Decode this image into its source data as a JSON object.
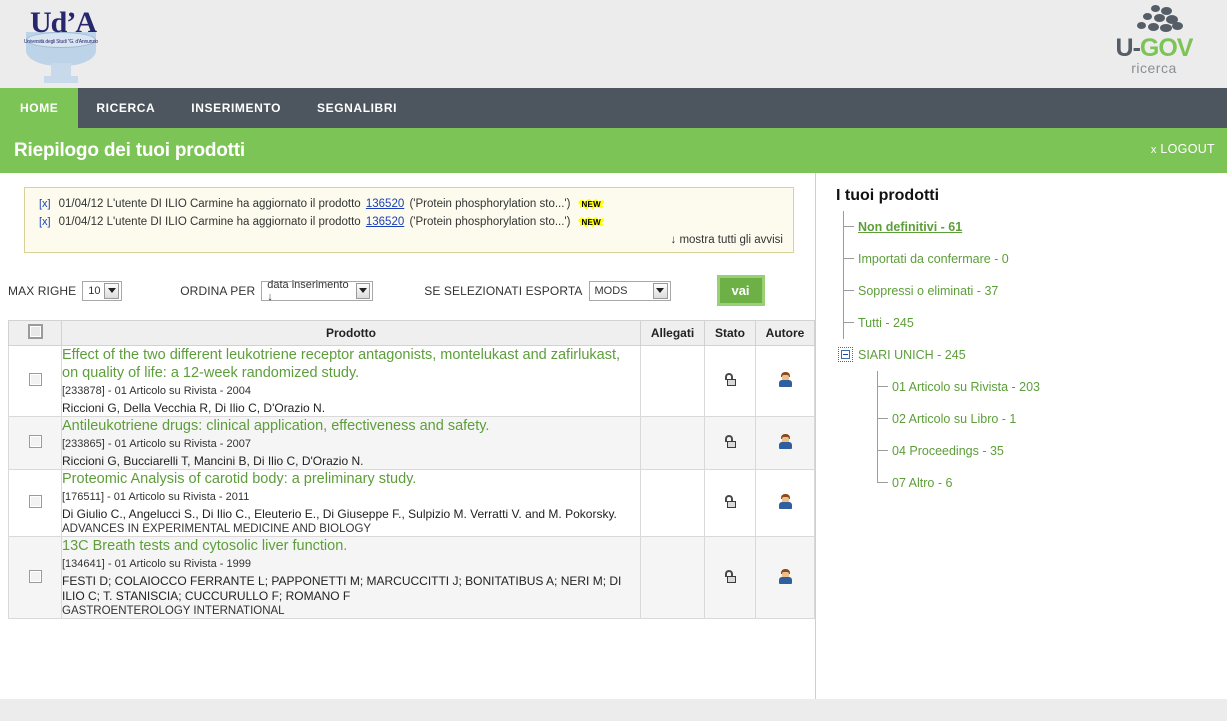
{
  "branding": {
    "uda_text": "Ud’A",
    "uda_subtitle": "Università degli Studi \"G. d'Annunzio\"",
    "ugov_u": "U-",
    "ugov_gov": "GOV",
    "ugov_sub": "ricerca"
  },
  "nav": {
    "items": [
      {
        "label": "HOME",
        "active": true
      },
      {
        "label": "RICERCA",
        "active": false
      },
      {
        "label": "INSERIMENTO",
        "active": false
      },
      {
        "label": "SEGNALIBRI",
        "active": false
      }
    ]
  },
  "banner": {
    "title": "Riepilogo dei tuoi prodotti",
    "logout_x": "x",
    "logout_label": "LOGOUT"
  },
  "notices": {
    "close_label": "[x]",
    "items": [
      {
        "date": "01/04/12",
        "text_before": "L'utente DI ILIO Carmine ha aggiornato il prodotto",
        "product_id": "136520",
        "text_after": "('Protein phosphorylation sto...')",
        "badge": "NEW"
      },
      {
        "date": "01/04/12",
        "text_before": "L'utente DI ILIO Carmine ha aggiornato il prodotto",
        "product_id": "136520",
        "text_after": "('Protein phosphorylation sto...')",
        "badge": "NEW"
      }
    ],
    "show_all": "↓ mostra tutti gli avvisi"
  },
  "toolbar": {
    "max_righe_label": "MAX RIGHE",
    "max_righe_value": "10",
    "ordina_per_label": "ORDINA PER",
    "ordina_per_value": "data inserimento ↓",
    "esporta_label": "SE SELEZIONATI ESPORTA",
    "esporta_value": "MODS",
    "go_label": "vai"
  },
  "table": {
    "headers": {
      "select": "",
      "prodotto": "Prodotto",
      "allegati": "Allegati",
      "stato": "Stato",
      "autore": "Autore"
    },
    "rows": [
      {
        "title": "Effect of the two different leukotriene receptor antagonists, montelukast and zafirlukast, on quality of life: a 12-week randomized study.",
        "meta": "[233878] - 01 Articolo su Rivista - 2004",
        "authors": "Riccioni G, Della Vecchia R, Di Ilio C, D'Orazio N.",
        "journal": "",
        "allegati": "",
        "stato_icon": "open-padlock-icon",
        "autore_icon": "user-avatar-icon"
      },
      {
        "title": "Antileukotriene drugs: clinical application, effectiveness and safety.",
        "meta": "[233865] - 01 Articolo su Rivista - 2007",
        "authors": "Riccioni G, Bucciarelli T, Mancini B, Di Ilio C, D'Orazio N.",
        "journal": "",
        "allegati": "",
        "stato_icon": "open-padlock-icon",
        "autore_icon": "user-avatar-icon"
      },
      {
        "title": "Proteomic Analysis of carotid body: a preliminary study.",
        "meta": "[176511] - 01 Articolo su Rivista - 2011",
        "authors": "Di Giulio C., Angelucci S., Di Ilio C., Eleuterio E., Di Giuseppe F., Sulpizio M. Verratti V. and M. Pokorsky.",
        "journal": "ADVANCES IN EXPERIMENTAL MEDICINE AND BIOLOGY",
        "allegati": "",
        "stato_icon": "open-padlock-icon",
        "autore_icon": "user-avatar-icon"
      },
      {
        "title": "13C Breath tests and cytosolic liver function.",
        "meta": "[134641] - 01 Articolo su Rivista - 1999",
        "authors": "FESTI D; COLAIOCCO FERRANTE L; PAPPONETTI M; MARCUCCITTI J; BONITATIBUS A; NERI M; DI ILIO C; T. STANISCIA; CUCCURULLO F; ROMANO F",
        "journal": "GASTROENTEROLOGY INTERNATIONAL",
        "allegati": "",
        "stato_icon": "open-padlock-icon",
        "autore_icon": "user-avatar-icon"
      }
    ]
  },
  "sidebar": {
    "title": "I tuoi prodotti",
    "nodes": [
      {
        "label": "Non definitivi - 61",
        "current": true
      },
      {
        "label": "Importati da confermare - 0",
        "current": false
      },
      {
        "label": "Soppressi o eliminati - 37",
        "current": false
      },
      {
        "label": "Tutti - 245",
        "current": false
      },
      {
        "label": "SIARI UNICH - 245",
        "current": false,
        "expander": true
      }
    ],
    "children": [
      {
        "label": "01 Articolo su Rivista - 203"
      },
      {
        "label": "02 Articolo su Libro - 1"
      },
      {
        "label": "04 Proceedings - 35"
      },
      {
        "label": "07 Altro - 6"
      }
    ]
  },
  "colors": {
    "green_accent": "#7dc457",
    "nav_dark": "#4d555e",
    "link_green": "#5d9e3a",
    "link_blue": "#1a3fb8",
    "notice_bg": "#fcfbee",
    "badge_yellow": "#ffff00"
  }
}
